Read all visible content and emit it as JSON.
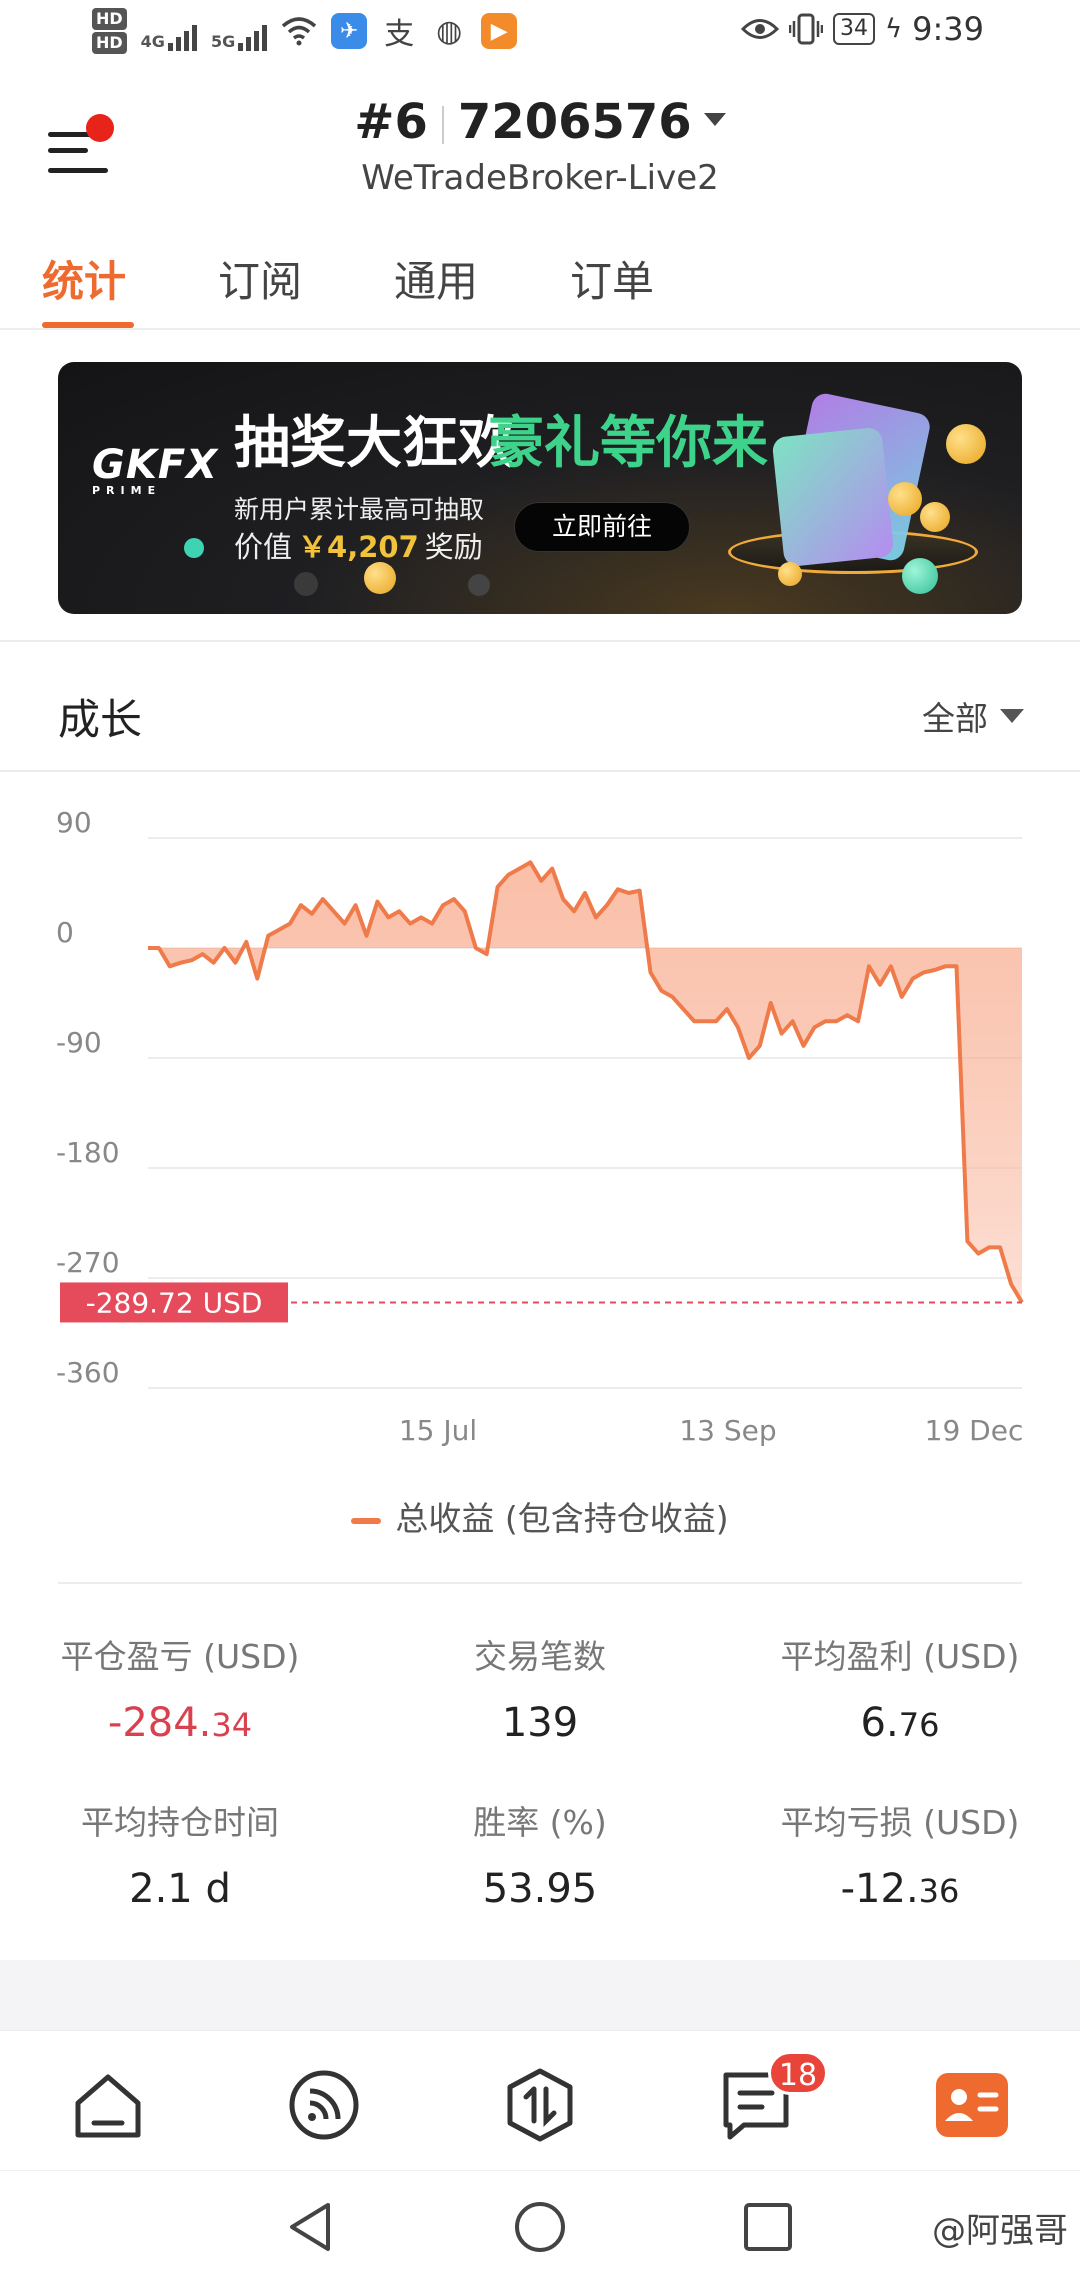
{
  "status_bar": {
    "net1": "4G",
    "net2": "5G",
    "battery": "34",
    "time": "9:39"
  },
  "header": {
    "account_num": "#6",
    "account_id": "7206576",
    "server": "WeTradeBroker-Live2"
  },
  "tabs": [
    "统计",
    "订阅",
    "通用",
    "订单"
  ],
  "banner": {
    "logo": "GKFX",
    "logo_sub": "PRIME",
    "headline_white": "抽奖大狂欢",
    "headline_green": "豪礼等你来",
    "line1": "新用户累计最高可抽取",
    "line2_prefix": "价值",
    "amount": "￥4,207",
    "line2_suffix": "奖励",
    "button": "立即前往"
  },
  "growth": {
    "title": "成长",
    "filter": "全部"
  },
  "chart_data": {
    "type": "area",
    "ylim": [
      -360,
      90
    ],
    "yticks": [
      "90",
      "0",
      "-90",
      "-180",
      "-270",
      "-360"
    ],
    "xticks": [
      "15 Jul",
      "13 Sep",
      "19 Dec"
    ],
    "current_value_label": "-289.72 USD",
    "series": [
      {
        "name": "总收益 (包含持仓收益)",
        "values": [
          0,
          0,
          -15,
          -12,
          -10,
          -5,
          -12,
          0,
          -12,
          5,
          -25,
          10,
          15,
          20,
          35,
          28,
          40,
          30,
          20,
          35,
          10,
          38,
          25,
          30,
          20,
          25,
          20,
          35,
          40,
          30,
          0,
          -5,
          50,
          60,
          65,
          70,
          55,
          65,
          40,
          30,
          45,
          25,
          35,
          48,
          45,
          47,
          -20,
          -35,
          -40,
          -50,
          -60,
          -60,
          -60,
          -50,
          -65,
          -90,
          -80,
          -45,
          -70,
          -60,
          -80,
          -65,
          -60,
          -60,
          -55,
          -60,
          -15,
          -30,
          -15,
          -40,
          -25,
          -20,
          -18,
          -15,
          -15,
          -240,
          -250,
          -245,
          -245,
          -275,
          -290
        ]
      }
    ]
  },
  "stats": [
    {
      "label": "平仓盈亏 (USD)",
      "int": "-284.",
      "dec": "34",
      "negative": true
    },
    {
      "label": "交易笔数",
      "int": "139",
      "dec": "",
      "negative": false
    },
    {
      "label": "平均盈利 (USD)",
      "int": "6.",
      "dec": "76",
      "negative": false
    },
    {
      "label": "平均持仓时间",
      "int": "2.1 d",
      "dec": "",
      "negative": false
    },
    {
      "label": "胜率 (%)",
      "int": "53.95",
      "dec": "",
      "negative": false
    },
    {
      "label": "平均亏损 (USD)",
      "int": "-12.",
      "dec": "36",
      "negative": false
    }
  ],
  "bottom_nav": {
    "badge": "18",
    "items": [
      "home-icon",
      "feed-icon",
      "trade-icon",
      "messages-icon",
      "profile-icon"
    ]
  },
  "watermark": "@阿强哥",
  "colors": {
    "accent": "#ef6a2f",
    "line": "#ef7a4a",
    "negative": "#d9414f",
    "badge": "#e8443a",
    "current_label_bg": "#e64b5b"
  }
}
